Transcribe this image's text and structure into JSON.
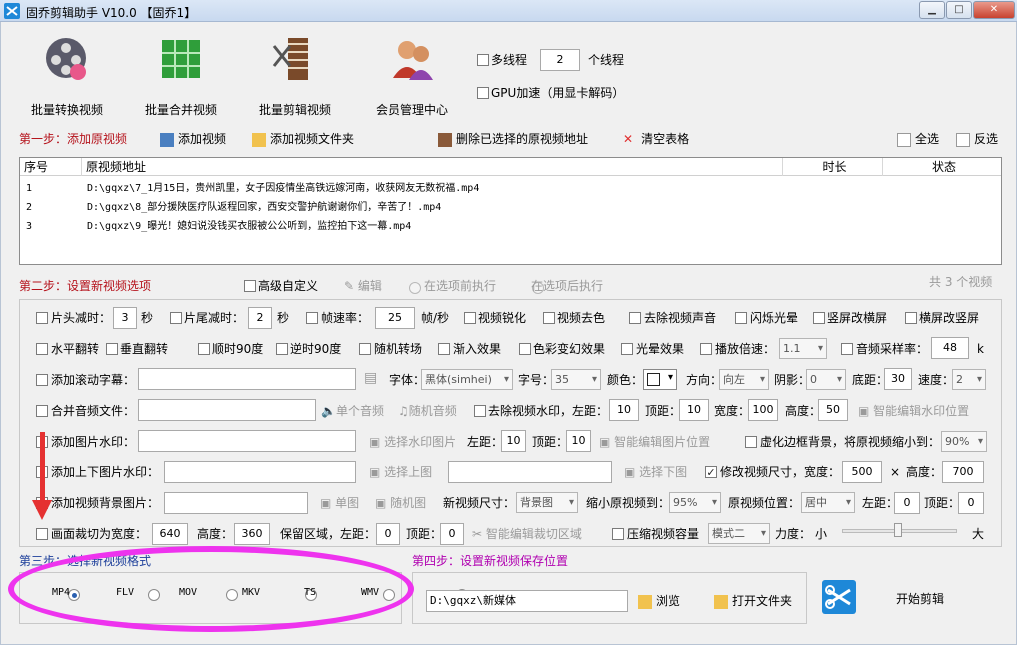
{
  "app": {
    "title": "固乔剪辑助手 V10.0  【固乔1】"
  },
  "window_buttons": {
    "minimize": "▁",
    "maximize": "□",
    "close": "✕"
  },
  "toolbar": {
    "batch_convert": "批量转换视频",
    "batch_merge": "批量合并视频",
    "batch_edit": "批量剪辑视频",
    "member_center": "会员管理中心",
    "multithread_label": "多线程",
    "thread_count": "2",
    "thread_unit": "个线程",
    "gpu_label": "GPU加速（用显卡解码）"
  },
  "step1": {
    "title": "第一步：添加原视频",
    "add_video": "添加视频",
    "add_folder": "添加视频文件夹",
    "delete_selected": "删除已选择的原视频地址",
    "clear_table": "清空表格",
    "select_all": "全选",
    "invert": "反选"
  },
  "table": {
    "headers": [
      "序号",
      "原视频地址",
      "时长",
      "状态"
    ],
    "rows": [
      {
        "n": "1",
        "path": "D:\\gqxz\\7_1月15日，贵州凯里，女子因疫情坐高铁远嫁河南，收获网友无数祝福.mp4"
      },
      {
        "n": "2",
        "path": "D:\\gqxz\\8_部分援陕医疗队返程回家，西安交警护航谢谢你们，辛苦了！.mp4"
      },
      {
        "n": "3",
        "path": "D:\\gqxz\\9_曝光！媳妇说没钱买衣服被公公听到，监控拍下这一幕.mp4"
      }
    ]
  },
  "step2": {
    "title": "第二步：设置新视频选项",
    "advanced": "高级自定义",
    "edit": "编辑",
    "before": "在选项前执行",
    "after": "在选项后执行",
    "count": "共 3 个视频"
  },
  "opts": {
    "head_cut": "片头减时：",
    "head_val": "3",
    "sec": "秒",
    "tail_cut": "片尾减时：",
    "tail_val": "2",
    "sec2": "秒",
    "fps": "帧速率：",
    "fps_val": "25",
    "fps_unit": "帧/秒",
    "sharpen": "视频锐化",
    "decolor": "视频去色",
    "remove_audio": "去除视频声音",
    "flash": "闪烁光晕",
    "v2h": "竖屏改横屏",
    "h2v": "横屏改竖屏",
    "hflip": "水平翻转",
    "vflip": "垂直翻转",
    "cw90": "顺时90度",
    "ccw90": "逆时90度",
    "random_turn": "随机转场",
    "fade_in": "渐入效果",
    "color_change": "色彩变幻效果",
    "halo": "光晕效果",
    "speed": "播放倍速：",
    "speed_val": "1.1",
    "sample_rate": "音频采样率：",
    "sample_val": "48",
    "k": "k",
    "scroll_sub": "添加滚动字幕：",
    "font": "字体：",
    "font_val": "黑体(simhei)",
    "size": "字号：",
    "size_val": "35",
    "color": "颜色：",
    "direction": "方向：",
    "dir_val": "向左",
    "shadow": "阴影：",
    "shadow_val": "0",
    "bottom": "底距：",
    "bottom_val": "30",
    "spd": "速度：",
    "spd_val": "2",
    "merge_audio": "合并音频文件：",
    "single_audio": "单个音频",
    "random_audio": "随机音频",
    "remove_wm": "去除视频水印，左距：",
    "wm_left": "10",
    "top": "顶距：",
    "wm_top": "10",
    "width": "宽度：",
    "wm_w": "100",
    "height": "高度：",
    "wm_h": "50",
    "smart_wm": "智能编辑水印位置",
    "img_wm": "添加图片水印：",
    "choose_wm": "选择水印图片",
    "left": "左距：",
    "iw_left": "10",
    "top2": "顶距：",
    "iw_top": "10",
    "smart_img": "智能编辑图片位置",
    "blur_bg": "虚化边框背景，将原视频缩小到：",
    "blur_val": "90%",
    "updown_wm": "添加上下图片水印：",
    "up_img": "选择上图",
    "down_img": "选择下图",
    "resize": "修改视频尺寸，宽度：",
    "resize_w": "500",
    "x": "×",
    "height2": "高度：",
    "resize_h": "700",
    "bg_img": "添加视频背景图片：",
    "single_img": "单图",
    "random_img": "随机图",
    "new_size": "新视频尺寸：",
    "new_size_val": "背景图",
    "shrink": "缩小原视频到：",
    "shrink_val": "95%",
    "orig_pos": "原视频位置：",
    "pos_val": "居中",
    "left2": "左距：",
    "bg_left": "0",
    "top3": "顶距：",
    "bg_top": "0",
    "crop": "画面裁切为宽度：",
    "crop_w": "640",
    "height3": "高度：",
    "crop_h": "360",
    "keep_left": "保留区域，左距：",
    "keep_left_val": "0",
    "top4": "顶距：",
    "keep_top_val": "0",
    "smart_crop": "智能编辑裁切区域",
    "compress": "压缩视频容量",
    "mode": "模式二",
    "force": "力度：",
    "small": "小",
    "big": "大"
  },
  "step3": {
    "title": "第三步：选择新视频格式",
    "formats": [
      "MP4",
      "FLV",
      "MOV",
      "MKV",
      "TS",
      "WMV"
    ],
    "selected": "MP4"
  },
  "step4": {
    "title": "第四步：设置新视频保存位置",
    "path": "D:\\gqxz\\新媒体",
    "browse": "浏览",
    "open_folder": "打开文件夹",
    "start": "开始剪辑"
  },
  "colors": {
    "step_red": "#b5121b",
    "step_blue": "#1c3e9a",
    "step_purple": "#b000b0",
    "annotation_ring": "#ee33ee",
    "annotation_arrow": "#e53131"
  }
}
